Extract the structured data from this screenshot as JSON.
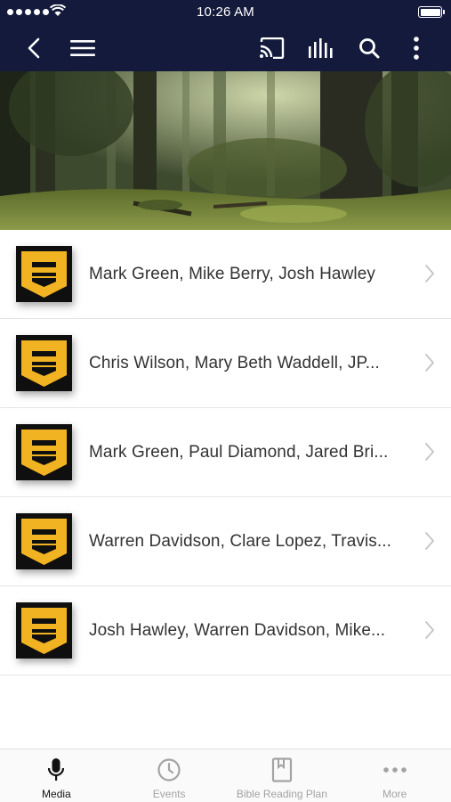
{
  "status_bar": {
    "time": "10:26 AM"
  },
  "nav": {
    "icons": [
      "back-icon",
      "menu-icon",
      "cast-icon",
      "audio-bars-icon",
      "search-icon",
      "more-vertical-icon"
    ]
  },
  "banner": {
    "image": "forest-banner"
  },
  "media_list": [
    {
      "title": "Mark Green, Mike Berry, Josh Hawley"
    },
    {
      "title": "Chris Wilson, Mary Beth Waddell, JP..."
    },
    {
      "title": "Mark Green, Paul Diamond, Jared Bri..."
    },
    {
      "title": "Warren Davidson, Clare Lopez, Travis..."
    },
    {
      "title": "Josh Hawley, Warren Davidson, Mike..."
    }
  ],
  "tabs": [
    {
      "label": "Media",
      "icon": "microphone-icon",
      "active": true
    },
    {
      "label": "Events",
      "icon": "clock-icon",
      "active": false
    },
    {
      "label": "Bible Reading Plan",
      "icon": "bookmark-book-icon",
      "active": false
    },
    {
      "label": "More",
      "icon": "more-horizontal-icon",
      "active": false
    }
  ],
  "colors": {
    "nav_bg": "#141a3c",
    "logo_gold": "#f2b323",
    "logo_black": "#0f0f0f",
    "tab_active": "#111111",
    "tab_inactive": "#a3a3a3"
  }
}
